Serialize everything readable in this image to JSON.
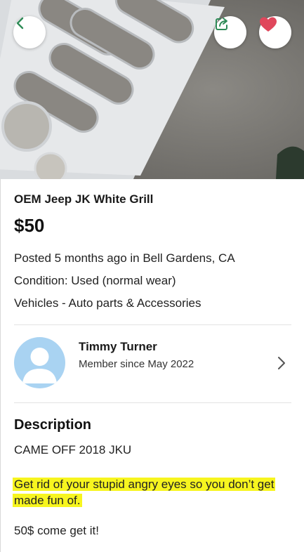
{
  "colors": {
    "accent_heart": "#e0475c",
    "back_chevron": "#2e8b57",
    "highlight": "#f7f51f",
    "avatar_bg": "#a9d3f2"
  },
  "header": {
    "back_icon": "chevron-left-icon",
    "share_icon": "share-icon",
    "favorite_icon": "heart-icon"
  },
  "listing": {
    "title": "OEM Jeep JK White Grill",
    "price": "$50",
    "posted": "Posted 5 months ago in Bell Gardens, CA",
    "condition": "Condition: Used (normal wear)",
    "category": "Vehicles - Auto parts & Accessories"
  },
  "seller": {
    "name": "Timmy Turner",
    "member_since": "Member since May 2022"
  },
  "description": {
    "heading": "Description",
    "line1": "CAME OFF 2018 JKU",
    "highlighted": "Get rid of your stupid angry eyes so you don’t get made fun of.",
    "line3": "50$ come get it!"
  }
}
